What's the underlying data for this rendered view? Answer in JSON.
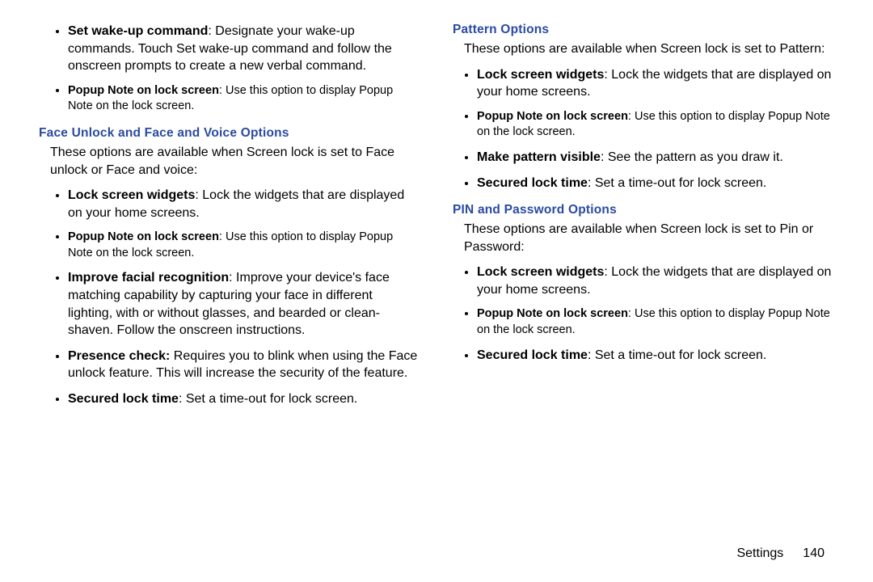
{
  "left": {
    "top_bullets": [
      {
        "bold": "Set wake-up command",
        "rest": ": Designate your wake-up commands. Touch Set wake-up command and follow the onscreen prompts to create a new verbal command.",
        "small": false
      },
      {
        "bold": "Popup Note on lock screen",
        "rest": ": Use this option to display Popup Note on the lock screen.",
        "small": true
      }
    ],
    "section1": {
      "title": "Face Unlock and Face and Voice Options",
      "intro": "These options are available when Screen lock is set to Face unlock or Face and voice:",
      "bullets": [
        {
          "bold": "Lock screen widgets",
          "rest": ": Lock the widgets that are displayed on your home screens.",
          "small": false
        },
        {
          "bold": "Popup Note on lock screen",
          "rest": ": Use this option to display Popup Note on the lock screen.",
          "small": true
        },
        {
          "bold": "Improve facial recognition",
          "rest": ": Improve your device's face matching capability by capturing your face in different lighting, with or without glasses, and bearded or clean-shaven. Follow the onscreen instructions.",
          "small": false
        },
        {
          "bold": "Presence check:",
          "rest": " Requires you to blink when using the Face unlock feature. This will increase the security of the feature.",
          "small": false
        },
        {
          "bold": "Secured lock time",
          "rest": ": Set a time-out for lock screen.",
          "small": false
        }
      ]
    }
  },
  "right": {
    "section1": {
      "title": "Pattern Options",
      "intro": "These options are available when Screen lock is set to Pattern:",
      "bullets": [
        {
          "bold": "Lock screen widgets",
          "rest": ": Lock the widgets that are displayed on your home screens.",
          "small": false
        },
        {
          "bold": "Popup Note on lock screen",
          "rest": ": Use this option to display Popup Note on the lock screen.",
          "small": true
        },
        {
          "bold": "Make pattern visible",
          "rest": ": See the pattern as you draw it.",
          "small": false
        },
        {
          "bold": "Secured lock time",
          "rest": ": Set a time-out for lock screen.",
          "small": false
        }
      ]
    },
    "section2": {
      "title": "PIN and Password Options",
      "intro": "These options are available when Screen lock is set to Pin or Password:",
      "bullets": [
        {
          "bold": "Lock screen widgets",
          "rest": ": Lock the widgets that are displayed on your home screens.",
          "small": false
        },
        {
          "bold": "Popup Note on lock screen",
          "rest": ": Use this option to display Popup Note on the lock screen.",
          "small": true
        },
        {
          "bold": "Secured lock time",
          "rest": ": Set a time-out for lock screen.",
          "small": false
        }
      ]
    }
  },
  "footer": {
    "label": "Settings",
    "page": "140"
  }
}
